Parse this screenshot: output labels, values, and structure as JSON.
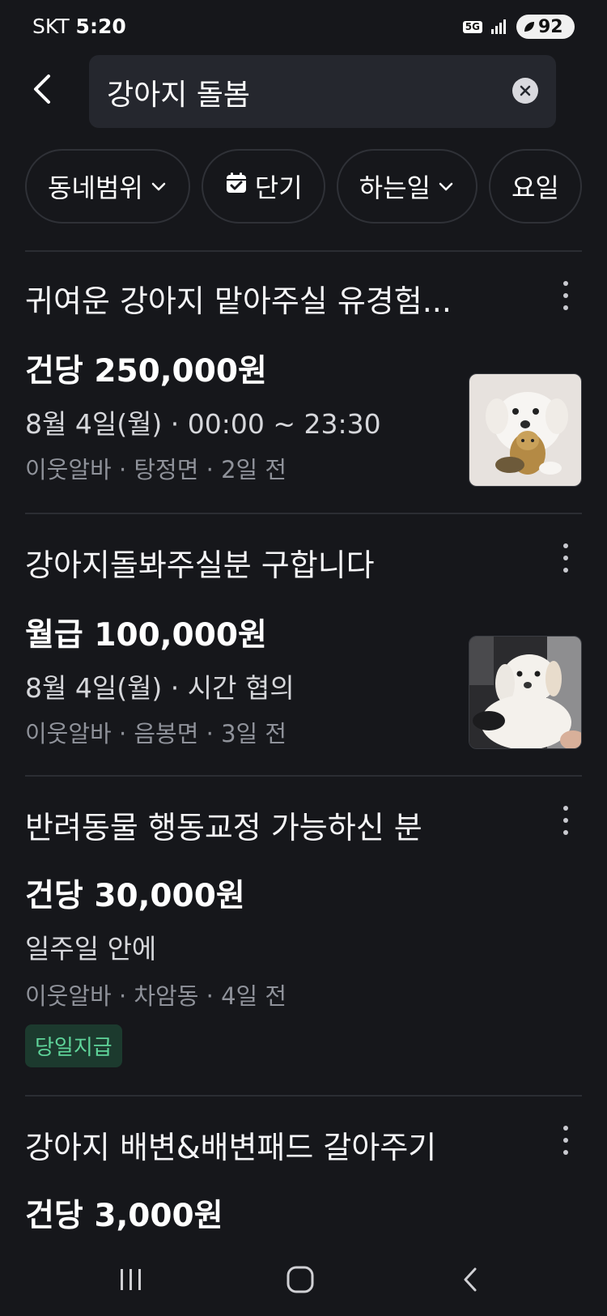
{
  "status_bar": {
    "carrier": "SKT",
    "time": "5:20",
    "network": "5G",
    "battery": "92"
  },
  "search": {
    "query": "강아지 돌봄"
  },
  "filters": [
    {
      "label": "동네범위",
      "icon": "chevron-down-icon"
    },
    {
      "label": "단기",
      "icon": "calendar-check-icon"
    },
    {
      "label": "하는일",
      "icon": "chevron-down-icon"
    },
    {
      "label": "요일",
      "icon": ""
    }
  ],
  "listings": [
    {
      "title": "귀여운 강아지 맡아주실 유경험...",
      "pay": "건당 250,000원",
      "schedule": "8월 4일(월) · 00:00 ~ 23:30",
      "meta": "이웃알바 · 탕정면 · 2일 전",
      "has_thumbnail": true
    },
    {
      "title": "강아지돌봐주실분 구합니다",
      "pay": "월급 100,000원",
      "schedule": "8월 4일(월) · 시간 협의",
      "meta": "이웃알바 · 음봉면 · 3일 전",
      "has_thumbnail": true
    },
    {
      "title": "반려동물 행동교정 가능하신 분",
      "pay": "건당 30,000원",
      "schedule": "일주일 안에",
      "meta": "이웃알바 · 차암동 · 4일 전",
      "badge": "당일지급",
      "has_thumbnail": false
    },
    {
      "title": "강아지 배변&배변패드 갈아주기",
      "pay": "건당 3,000원",
      "has_thumbnail": false
    }
  ],
  "colors": {
    "background": "#16171b",
    "search_field": "#25272e",
    "badge_bg": "#1c3a2e",
    "badge_text": "#5fd49a"
  }
}
